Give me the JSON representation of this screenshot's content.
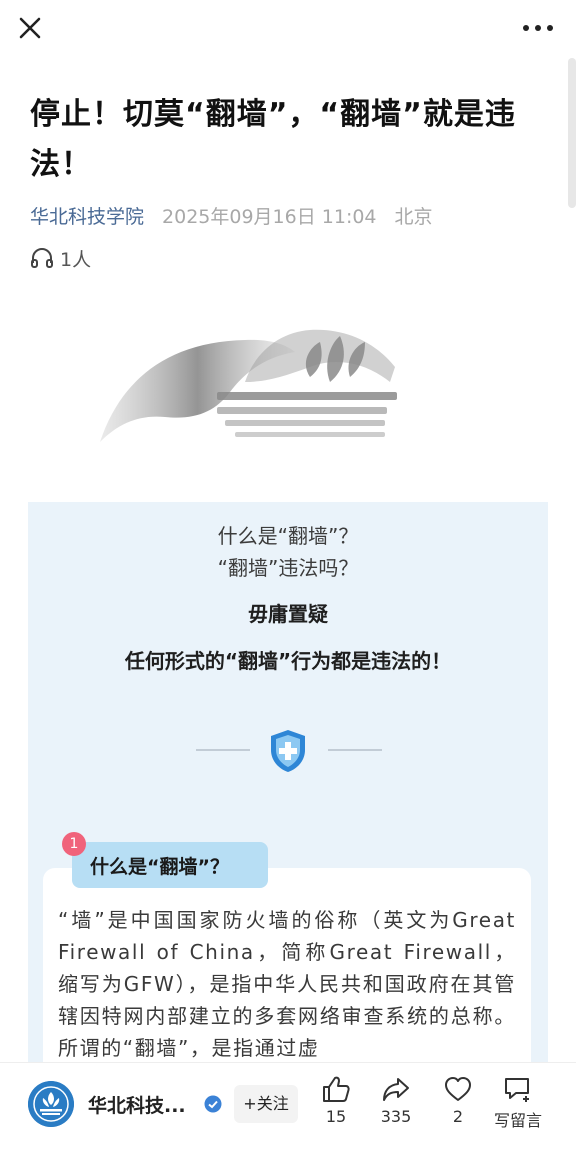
{
  "topbar": {
    "close_icon": "close-icon",
    "more_icon": "more-dots-icon"
  },
  "article": {
    "title": "停止！切莫“翻墙”，“翻墙”就是违法！",
    "author": "华北科技学院",
    "date": "2025年09月16日 11:04",
    "location": "北京",
    "listeners": "1人"
  },
  "card": {
    "question1": "什么是“翻墙”？",
    "question2": "“翻墙”违法吗？",
    "statement1": "毋庸置疑",
    "statement2": "任何形式的“翻墙”行为都是违法的！",
    "section_badge": "1",
    "section_title": "什么是“翻墙”？",
    "paragraph": "“墙”是中国国家防火墙的俗称（英文为Great Firewall of China，简称Great Firewall，缩写为GFW），是指中华人民共和国政府在其管辖因特网内部建立的多套网络审查系统的总称。所谓的“翻墙”，是指通过虚"
  },
  "bottombar": {
    "account_name": "华北科技...",
    "follow_label": "+关注",
    "like_count": "15",
    "share_count": "335",
    "favorite_count": "2",
    "comment_label": "写留言"
  },
  "colors": {
    "accent": "#4a6a95",
    "card_bg": "#eaf3fa",
    "badge": "#f0637b",
    "tag_bg": "#b7def4",
    "verified": "#3b82d6"
  }
}
